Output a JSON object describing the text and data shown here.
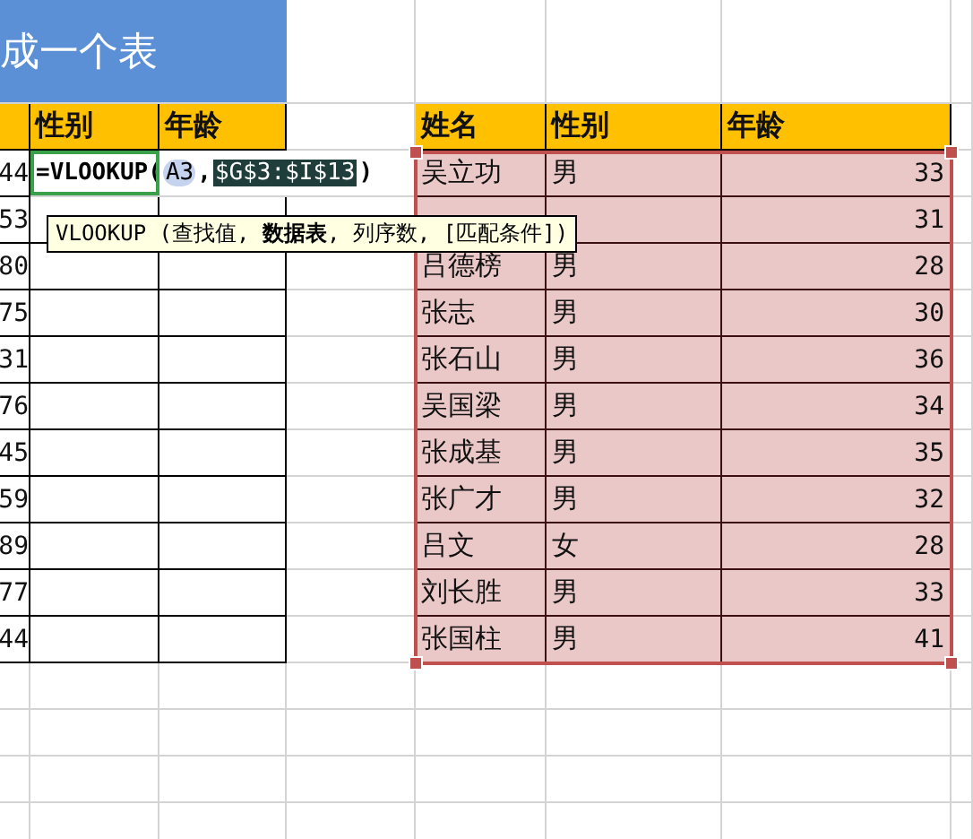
{
  "banner": {
    "title": "成一个表"
  },
  "left_table": {
    "columns": [
      "性别",
      "年龄"
    ],
    "row_values": [
      "44",
      "53",
      "80",
      "75",
      "31",
      "76",
      "45",
      "59",
      "89",
      "77",
      "44"
    ]
  },
  "formula": {
    "parts": [
      {
        "kind": "plain",
        "text": "=VLOOKUP("
      },
      {
        "kind": "ref",
        "text": "A3"
      },
      {
        "kind": "plain",
        "text": ","
      },
      {
        "kind": "selected",
        "text": "$G$3:$I$13"
      },
      {
        "kind": "plain",
        "text": ")"
      }
    ]
  },
  "tooltip": {
    "text": "VLOOKUP (查找值, **数据表**, 列序数, [匹配条件])"
  },
  "right_table": {
    "columns": [
      "姓名",
      "性别",
      "年龄"
    ],
    "rows": [
      {
        "name": "吴立功",
        "gender": "男",
        "age": "33"
      },
      {
        "age": "31"
      },
      {
        "name": "吕德榜",
        "gender": "男",
        "age": "28"
      },
      {
        "name": "张志",
        "gender": "男",
        "age": "30"
      },
      {
        "name": "张石山",
        "gender": "男",
        "age": "36"
      },
      {
        "name": "吴国梁",
        "gender": "男",
        "age": "34"
      },
      {
        "name": "张成基",
        "gender": "男",
        "age": "35"
      },
      {
        "name": "张广才",
        "gender": "男",
        "age": "32"
      },
      {
        "name": "吕文",
        "gender": "女",
        "age": "28"
      },
      {
        "name": "刘长胜",
        "gender": "男",
        "age": "33"
      },
      {
        "name": "张国柱",
        "gender": "男",
        "age": "41"
      }
    ]
  }
}
